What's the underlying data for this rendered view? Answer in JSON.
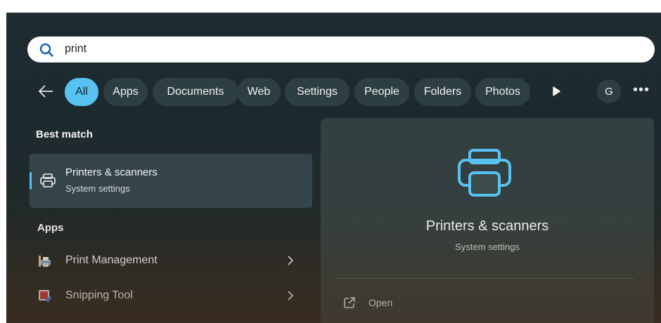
{
  "search": {
    "value": "print"
  },
  "filters": {
    "back_icon": "arrow-left-icon",
    "chips": [
      "All",
      "Apps",
      "Documents",
      "Web",
      "Settings",
      "People",
      "Folders",
      "Photos"
    ],
    "active": "All",
    "play_icon": "play-icon",
    "avatar_letter": "G",
    "more_icon": "more-horizontal-icon"
  },
  "results": {
    "best_match_heading": "Best match",
    "best_match": {
      "title": "Printers & scanners",
      "subtitle": "System settings",
      "icon": "printer-icon"
    },
    "apps_heading": "Apps",
    "apps": [
      {
        "label": "Print Management",
        "icon": "print-management-icon"
      },
      {
        "label": "Snipping Tool",
        "icon": "snipping-tool-icon"
      }
    ]
  },
  "preview": {
    "icon": "printer-icon",
    "title": "Printers & scanners",
    "subtitle": "System settings",
    "actions": [
      {
        "label": "Open",
        "icon": "open-external-icon"
      }
    ]
  },
  "colors": {
    "accent": "#58c2f2",
    "chip_bg": "#2e3f43",
    "selected_row_bg": "#34444a"
  }
}
